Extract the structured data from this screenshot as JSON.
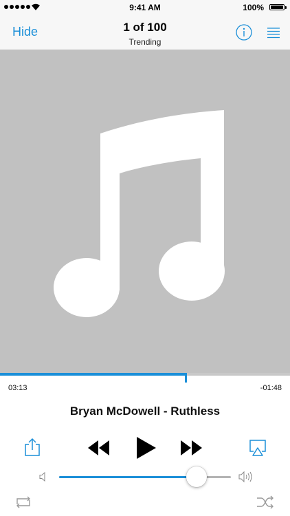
{
  "status_bar": {
    "time": "9:41 AM",
    "battery": "100%"
  },
  "nav": {
    "hide_label": "Hide",
    "title": "1 of 100",
    "subtitle": "Trending"
  },
  "player": {
    "elapsed": "03:13",
    "remaining": "-01:48",
    "progress_fraction": 0.64,
    "track_title": "Bryan McDowell - Ruthless",
    "volume_fraction": 0.8
  },
  "icons": {
    "info": "info-icon",
    "list": "list-icon",
    "artwork": "music-note-icon",
    "share": "share-icon",
    "rewind": "rewind-icon",
    "play": "play-icon",
    "fast_forward": "fast-forward-icon",
    "airplay": "airplay-icon",
    "volume_low": "volume-low-icon",
    "volume_high": "volume-high-icon",
    "repeat": "repeat-icon",
    "shuffle": "shuffle-icon"
  },
  "colors": {
    "accent": "#1b8fd8",
    "artwork_bg": "#c1c1c1",
    "control": "#000000",
    "secondary_control": "#999999"
  }
}
